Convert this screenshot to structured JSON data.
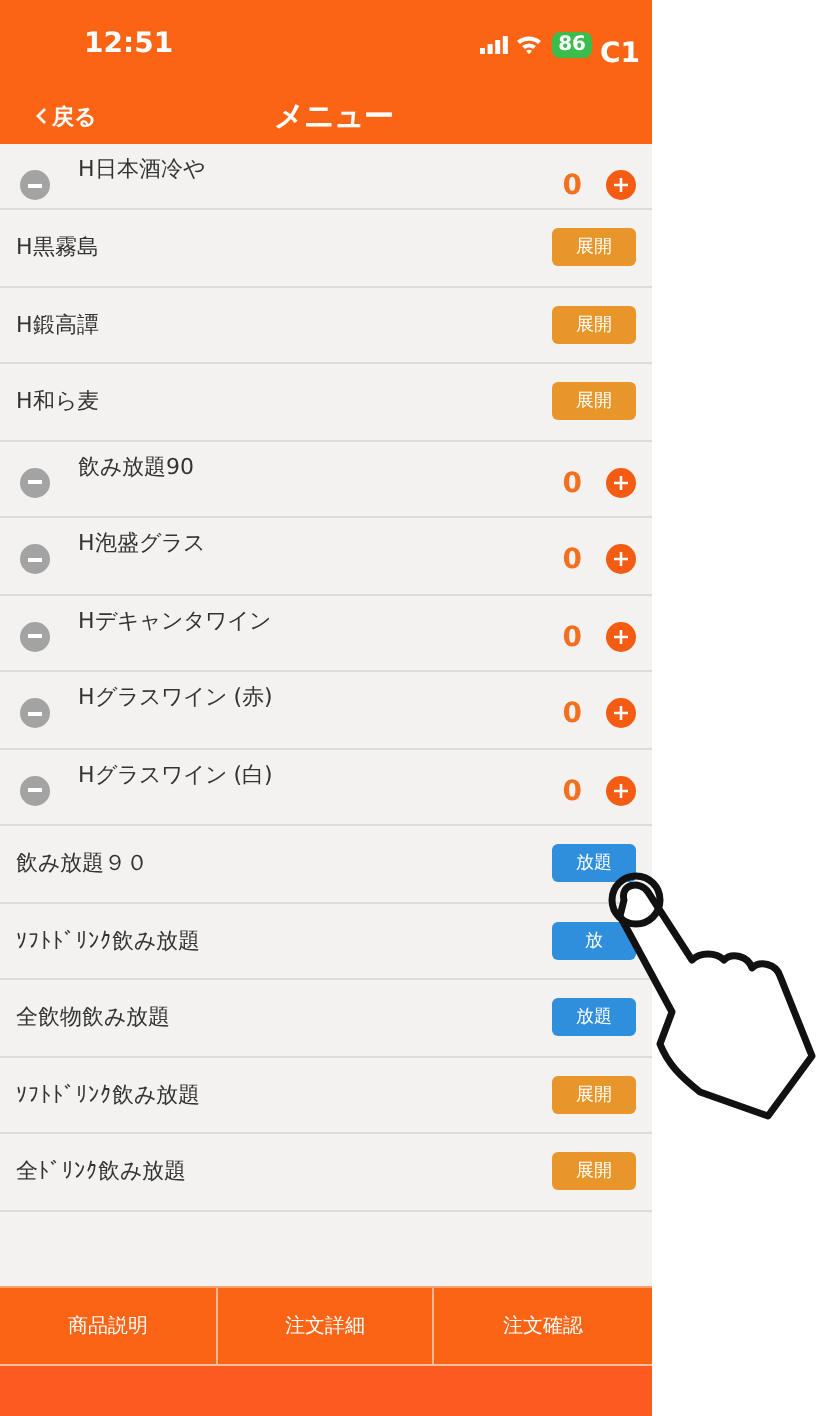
{
  "status_bar": {
    "time": "12:51",
    "battery": "86",
    "carrier_tag": "C1"
  },
  "nav": {
    "back": "戻る",
    "title": "メニュー"
  },
  "items": [
    {
      "kind": "counter",
      "name": "H日本酒冷や",
      "count": "0"
    },
    {
      "kind": "expand",
      "name": "H黒霧島",
      "button": "展開"
    },
    {
      "kind": "expand",
      "name": "H鍛高譚",
      "button": "展開"
    },
    {
      "kind": "expand",
      "name": "H和ら麦",
      "button": "展開"
    },
    {
      "kind": "counter",
      "name": "飲み放題90",
      "count": "0"
    },
    {
      "kind": "counter",
      "name": "H泡盛グラス",
      "count": "0"
    },
    {
      "kind": "counter",
      "name": "Hデキャンタワイン",
      "count": "0"
    },
    {
      "kind": "counter",
      "name": "Hグラスワイン (赤)",
      "count": "0"
    },
    {
      "kind": "counter",
      "name": "Hグラスワイン (白)",
      "count": "0"
    },
    {
      "kind": "plan",
      "name": "飲み放題９０",
      "button": "放題"
    },
    {
      "kind": "plan",
      "name": "ｿﾌﾄﾄﾞﾘﾝｸ飲み放題",
      "button": "放"
    },
    {
      "kind": "plan",
      "name": "全飲物飲み放題",
      "button": "放題"
    },
    {
      "kind": "expand",
      "name": "ｿﾌﾄﾄﾞﾘﾝｸ飲み放題",
      "button": "展開"
    },
    {
      "kind": "expand",
      "name": "全ﾄﾞﾘﾝｸ飲み放題",
      "button": "展開"
    }
  ],
  "footer_tabs": [
    "商品説明",
    "注文詳細",
    "注文確認"
  ]
}
